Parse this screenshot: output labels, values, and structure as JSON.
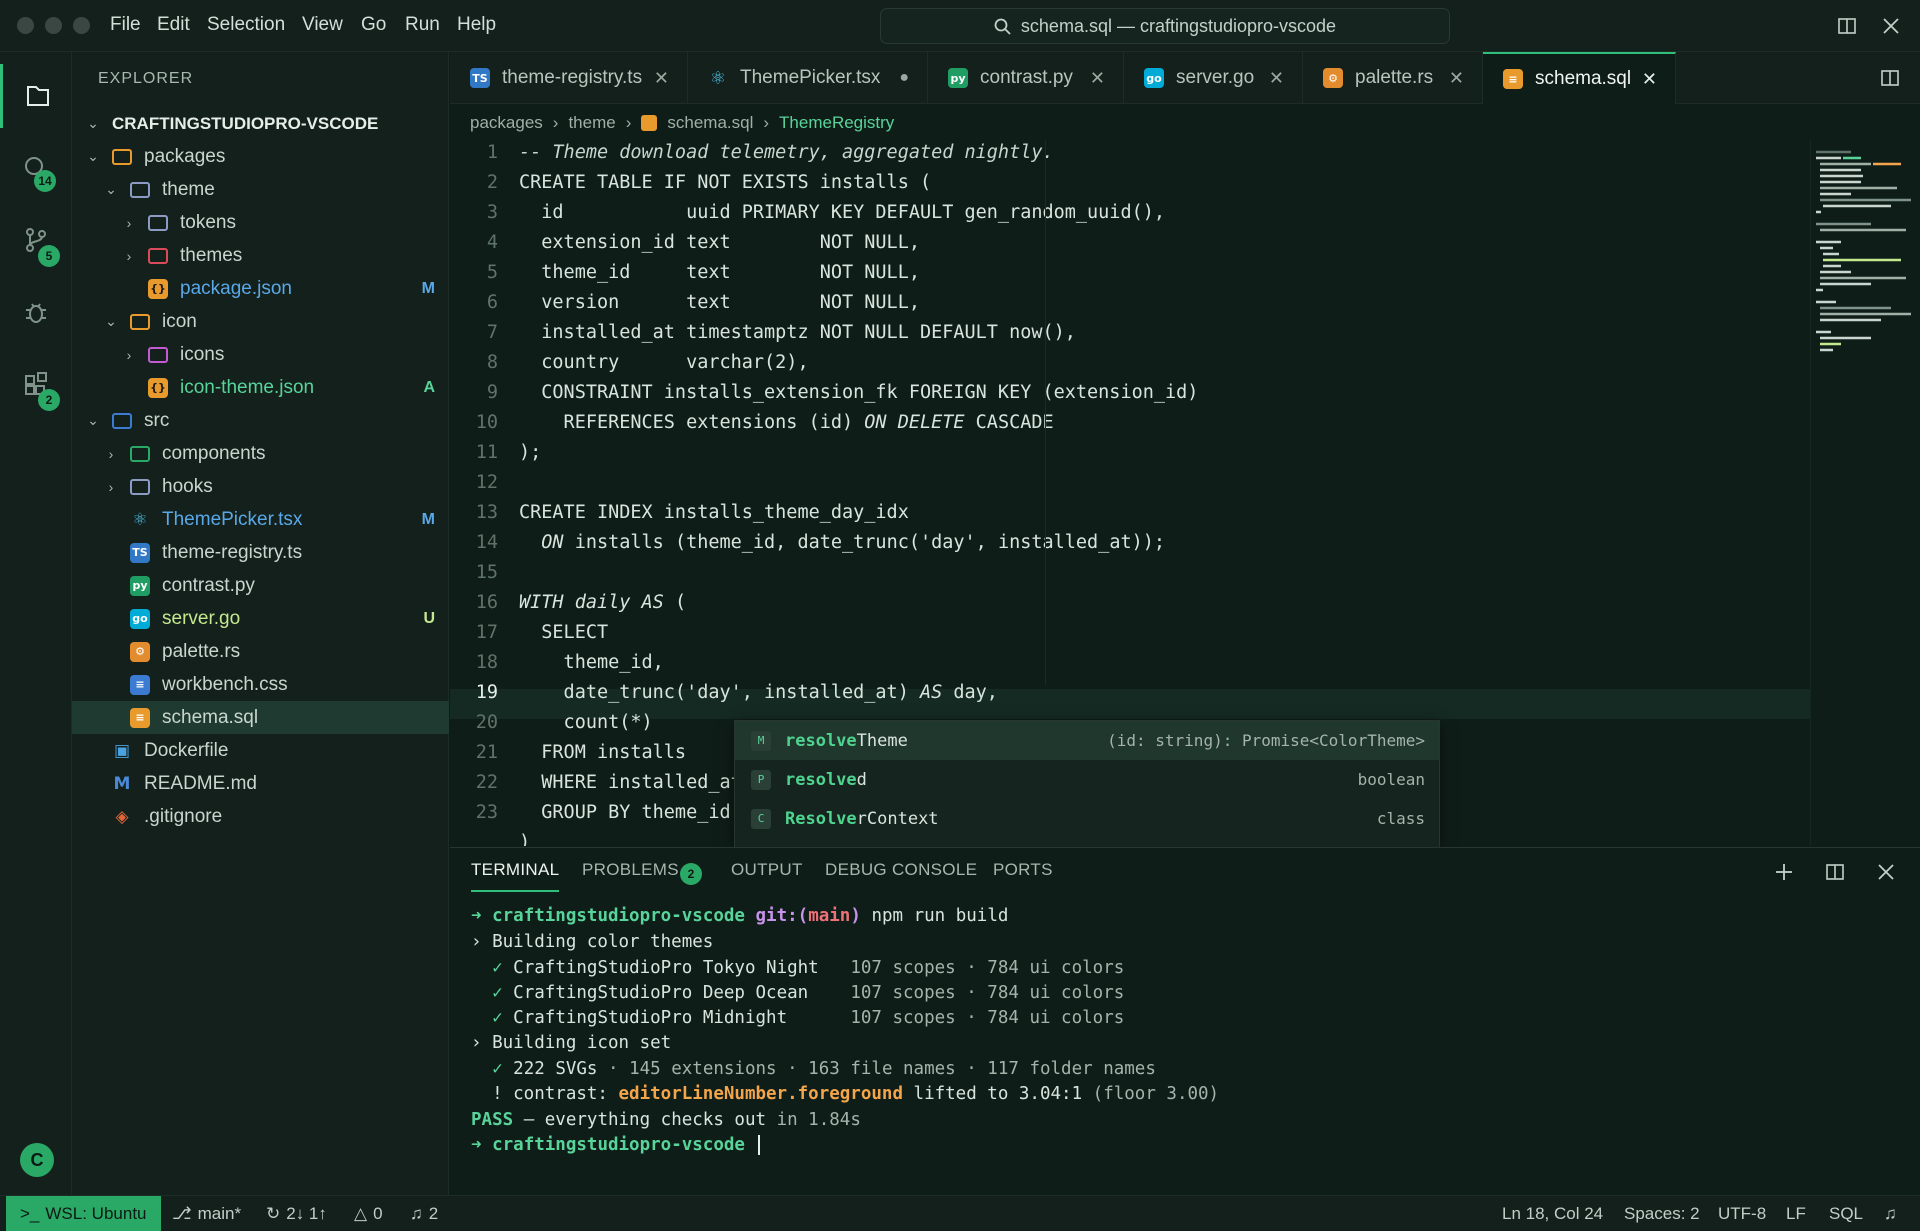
{
  "titlebar": {
    "menus": [
      "File",
      "Edit",
      "Selection",
      "View",
      "Go",
      "Run",
      "Help"
    ],
    "search_text": "schema.sql — craftingstudiopro-vscode",
    "icons": [
      "search-icon",
      "layout-icon",
      "close-icon"
    ]
  },
  "activity": {
    "search_badge": "14",
    "scm_badge": "5",
    "extensions_badge": "2",
    "account_initial": "C"
  },
  "explorer": {
    "header": "EXPLORER",
    "root": "CRAFTINGSTUDIOPRO-VSCODE",
    "items": [
      {
        "label": "packages",
        "kind": "folder-open",
        "status": ""
      },
      {
        "label": "theme",
        "kind": "folder-open",
        "status": ""
      },
      {
        "label": "tokens",
        "kind": "folder",
        "status": ""
      },
      {
        "label": "themes",
        "kind": "folder",
        "status": ""
      },
      {
        "label": "package.json",
        "kind": "json",
        "status": "M"
      },
      {
        "label": "icon",
        "kind": "folder-open",
        "status": ""
      },
      {
        "label": "icons",
        "kind": "folder",
        "status": ""
      },
      {
        "label": "icon-theme.json",
        "kind": "json",
        "status": "A"
      },
      {
        "label": "src",
        "kind": "folder-open",
        "status": ""
      },
      {
        "label": "components",
        "kind": "folder",
        "status": ""
      },
      {
        "label": "hooks",
        "kind": "folder",
        "status": ""
      },
      {
        "label": "ThemePicker.tsx",
        "kind": "react",
        "status": "M"
      },
      {
        "label": "theme-registry.ts",
        "kind": "ts",
        "status": ""
      },
      {
        "label": "contrast.py",
        "kind": "py",
        "status": ""
      },
      {
        "label": "server.go",
        "kind": "go",
        "status": "U"
      },
      {
        "label": "palette.rs",
        "kind": "rs",
        "status": ""
      },
      {
        "label": "workbench.css",
        "kind": "css",
        "status": ""
      },
      {
        "label": "schema.sql",
        "kind": "sql",
        "status": ""
      },
      {
        "label": "Dockerfile",
        "kind": "docker",
        "status": ""
      },
      {
        "label": "README.md",
        "kind": "md",
        "status": ""
      },
      {
        "label": ".gitignore",
        "kind": "git",
        "status": ""
      }
    ]
  },
  "tabs": [
    {
      "label": "theme-registry.ts",
      "icon": "TS"
    },
    {
      "label": "ThemePicker.tsx",
      "icon": "⚛"
    },
    {
      "label": "contrast.py",
      "icon": "py"
    },
    {
      "label": "server.go",
      "icon": "go"
    },
    {
      "label": "palette.rs",
      "icon": "⚙"
    },
    {
      "label": "schema.sql",
      "icon": "≡"
    }
  ],
  "breadcrumb": [
    "packages",
    "theme",
    "schema.sql",
    "ThemeRegistry"
  ],
  "editor": {
    "lines": [
      "-- Theme download telemetry, aggregated nightly.",
      "CREATE TABLE IF NOT EXISTS installs (",
      "  id           uuid PRIMARY KEY DEFAULT gen_random_uuid(),",
      "  extension_id text        NOT NULL,",
      "  theme_id     text        NOT NULL,",
      "  version      text        NOT NULL,",
      "  installed_at timestamptz NOT NULL DEFAULT now(),",
      "  country      varchar(2),",
      "  CONSTRAINT installs_extension_fk FOREIGN KEY (extension_id)",
      "    REFERENCES extensions (id) ON DELETE CASCADE",
      ");",
      "",
      "CREATE INDEX installs_theme_day_idx",
      "  ON installs (theme_id, date_trunc('day', installed_at));",
      "",
      "WITH daily AS (",
      "  SELECT",
      "    theme_id,",
      "    date_trunc('day', installed_at) AS day,",
      "    count(*)",
      "  FROM installs",
      "  WHERE installed_at",
      "  GROUP BY theme_id,"
    ],
    "current_line": 19
  },
  "suggest": [
    {
      "icon": "M",
      "match": "resolve",
      "rest": "Theme",
      "detail": "(id: string): Promise<ColorTheme>"
    },
    {
      "icon": "P",
      "match": "resolve",
      "rest": "d",
      "detail": "boolean"
    },
    {
      "icon": "C",
      "match": "Resolve",
      "rest": "rContext",
      "detail": "class"
    }
  ],
  "panel": {
    "tabs": [
      "TERMINAL",
      "PROBLEMS",
      "OUTPUT",
      "DEBUG CONSOLE",
      "PORTS"
    ],
    "problems_count": "2",
    "terminal": {
      "prompt_arrow": "➜",
      "cwd": "craftingstudiopro-vscode",
      "git_label": "git:(",
      "branch": "main",
      "git_close": ")",
      "command": "npm run build",
      "building_themes": "› Building color themes",
      "themes": [
        {
          "name": "CraftingStudioPro Tokyo Night",
          "stats": "107 scopes · 784 ui colors"
        },
        {
          "name": "CraftingStudioPro Deep Ocean ",
          "stats": "107 scopes · 784 ui colors"
        },
        {
          "name": "CraftingStudioPro Midnight   ",
          "stats": "107 scopes · 784 ui colors"
        }
      ],
      "building_icons": "› Building icon set",
      "svgs_count": "222 SVGs",
      "svgs_stats": " · 145 extensions · 163 file names · 117 folder names",
      "warn_prefix": "! contrast: ",
      "warn_key": "editorLineNumber.foreground",
      "warn_mid": " lifted to 3.04:1",
      "warn_tail": " (floor 3.00)",
      "pass": "PASS",
      "pass_mid": " — everything checks out",
      "pass_time": " in 1.84s"
    }
  },
  "status": {
    "remote": "WSL: Ubuntu",
    "branch": "main*",
    "sync": "2↓ 1↑",
    "errors": "0",
    "notifications": "2",
    "position": "Ln 18, Col 24",
    "spaces": "Spaces: 2",
    "encoding": "UTF-8",
    "eol": "LF",
    "language": "SQL"
  }
}
